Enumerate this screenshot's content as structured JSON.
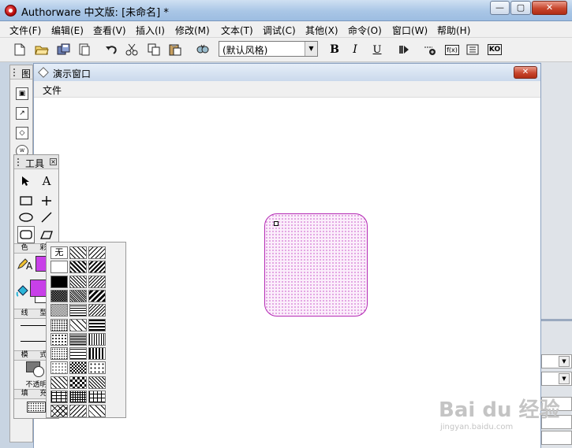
{
  "app": {
    "title": "Authorware 中文版: [未命名] *"
  },
  "window_controls": {
    "minimize": "—",
    "maximize": "▢",
    "close": "✕"
  },
  "menu": {
    "items": [
      {
        "label": "文件(F)"
      },
      {
        "label": "编辑(E)"
      },
      {
        "label": "查看(V)"
      },
      {
        "label": "插入(I)"
      },
      {
        "label": "修改(M)"
      },
      {
        "label": "文本(T)"
      },
      {
        "label": "调试(C)"
      },
      {
        "label": "其他(X)"
      },
      {
        "label": "命令(O)"
      },
      {
        "label": "窗口(W)"
      },
      {
        "label": "帮助(H)"
      }
    ]
  },
  "toolbar": {
    "style_select": "(默认风格)",
    "bold": "B",
    "italic": "I",
    "underline": "U",
    "icons": [
      "new-icon",
      "open-icon",
      "save-all-icon",
      "import-icon",
      "undo-icon",
      "cut-icon",
      "copy-icon",
      "paste-icon",
      "find-icon",
      "bold-icon",
      "italic-icon",
      "underline-icon",
      "run-icon",
      "control-panel-icon",
      "functions-icon",
      "variables-icon",
      "knowledge-objects-icon"
    ],
    "fn_label": "f(x)",
    "ko_label": "KO"
  },
  "icon_palette": {
    "title": "图"
  },
  "presentation_window": {
    "title": "演示窗口",
    "menu_file": "文件"
  },
  "tools_panel": {
    "title": "工具",
    "text_tool": "A",
    "color_label": "色 彩",
    "line_label": "线 型",
    "mode_label": "模 式",
    "mode_value": "不透明",
    "fill_label": "填 充",
    "shape_color": "#c840e8"
  },
  "fill_palette": {
    "none_label": "无"
  },
  "watermark": {
    "logo": "Bai du 经验",
    "url": "jingyan.baidu.com"
  }
}
